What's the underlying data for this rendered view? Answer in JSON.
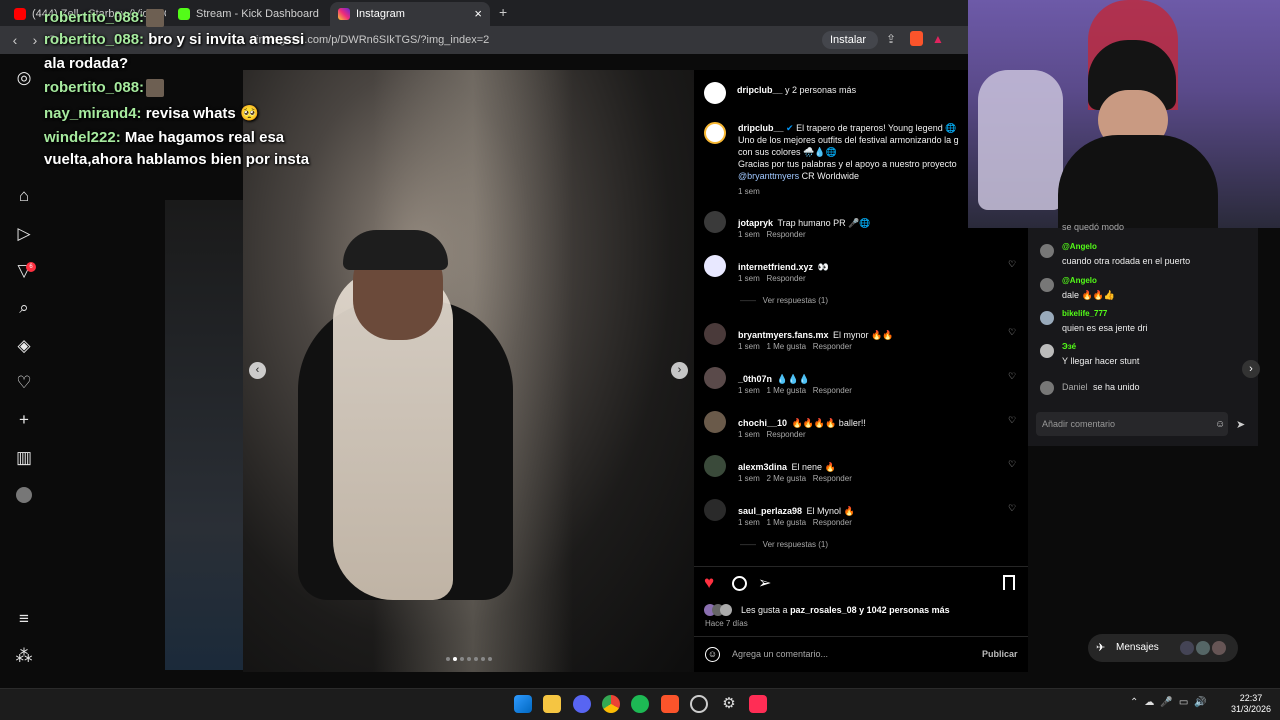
{
  "browser": {
    "tabs": [
      {
        "label": "(444) Zell - Starboy (Video Oficial)"
      },
      {
        "label": "Stream - Kick Dashboard"
      },
      {
        "label": "Instagram"
      }
    ],
    "new_tab": "+",
    "close_tab": "×",
    "url": "instagram.com/p/DWRn6SIkTGS/?img_index=2",
    "install_label": "Instalar"
  },
  "overlay_chat": [
    {
      "user": "robertito_088:",
      "message": "",
      "avatar": true
    },
    {
      "user": "robertito_088:",
      "message": "bro y si invita a messi",
      "avatar": false
    },
    {
      "user": "",
      "message": "ala rodada?",
      "avatar": false
    },
    {
      "user": "robertito_088:",
      "message": "",
      "avatar": true
    },
    {
      "user": "nay_mirand4:",
      "message": "revisa whats 🥺",
      "avatar": false
    },
    {
      "user": "windel222:",
      "message": "Mae hagamos real esa",
      "avatar": false
    },
    {
      "user": "",
      "message": "vuelta,ahora hablamos bien por insta",
      "avatar": false
    }
  ],
  "ig_rail": {
    "icons": [
      "instagram-icon",
      "home-icon",
      "reels-icon",
      "notifications-icon",
      "search-icon",
      "explore-icon",
      "heart-icon",
      "create-icon",
      "insights-icon",
      "profile-avatar",
      "menu-icon",
      "more-icon"
    ],
    "notif_badge": "6"
  },
  "post": {
    "header_user": "dripclub__",
    "header_extra": "y 2 personas más",
    "caption_user": "dripclub__",
    "caption_lines": [
      "El trapero de traperos! Young legend 🌐",
      "Uno de los mejores outfits del festival armonizando la g",
      "con sus colores 🌧️💧🌐",
      "Gracias por tus palabras y el apoyo a nuestro proyecto"
    ],
    "caption_mention": "@bryanttmyers",
    "caption_tail": "CR Worldwide",
    "caption_time": "1 sem",
    "comments": [
      {
        "user": "jotapryk",
        "text": "Trap humano PR 🎤🌐",
        "time": "1 sem",
        "likes": "",
        "reply": "Responder"
      },
      {
        "user": "internetfriend.xyz",
        "text": "👀",
        "time": "1 sem",
        "likes": "",
        "reply": "Responder"
      },
      {
        "user": "bryantmyers.fans.mx",
        "text": "El mynor 🔥🔥",
        "time": "1 sem",
        "likes": "1 Me gusta",
        "reply": "Responder"
      },
      {
        "user": "_0th07n",
        "text": "💧💧💧",
        "time": "1 sem",
        "likes": "1 Me gusta",
        "reply": "Responder"
      },
      {
        "user": "chochi__10",
        "text": "🔥🔥🔥🔥 baller!!",
        "time": "1 sem",
        "likes": "",
        "reply": "Responder"
      },
      {
        "user": "alexm3dina",
        "text": "El nene 🔥",
        "time": "1 sem",
        "likes": "2 Me gusta",
        "reply": "Responder"
      },
      {
        "user": "saul_perlaza98",
        "text": "El Mynol 🔥",
        "time": "1 sem",
        "likes": "1 Me gusta",
        "reply": "Responder"
      }
    ],
    "view_replies_1": "Ver respuestas (1)",
    "view_replies_2": "Ver respuestas (1)",
    "likes_prefix": "Les gusta a",
    "likes_user": "paz_rosales_08",
    "likes_suffix": "y 1042 personas más",
    "post_time": "Hace 7 días",
    "comment_placeholder": "Agrega un comentario...",
    "publish_label": "Publicar"
  },
  "kick_chat": {
    "partial_top": "se quedó modo",
    "messages": [
      {
        "user": "@Angelo",
        "text": "cuando otra rodada en el puerto"
      },
      {
        "user": "@Angelo",
        "text": "dale 🔥🔥👍"
      },
      {
        "user": "bikelife_777",
        "text": "quien es esa jente dri"
      },
      {
        "user": "Эзé",
        "text": "Y llegar hacer stunt"
      }
    ],
    "join_user": "Daniel",
    "join_text": "se ha unido",
    "input_placeholder": "Añadir comentario"
  },
  "messages_pill": {
    "label": "Mensajes"
  },
  "taskbar": {
    "time": "22:37",
    "date": "31/3/2026"
  },
  "colors": {
    "kick_green": "#53fc18",
    "overlay_user": "#a6ea9e",
    "like_red": "#ff3040",
    "mention_blue": "#a0c8ff"
  }
}
